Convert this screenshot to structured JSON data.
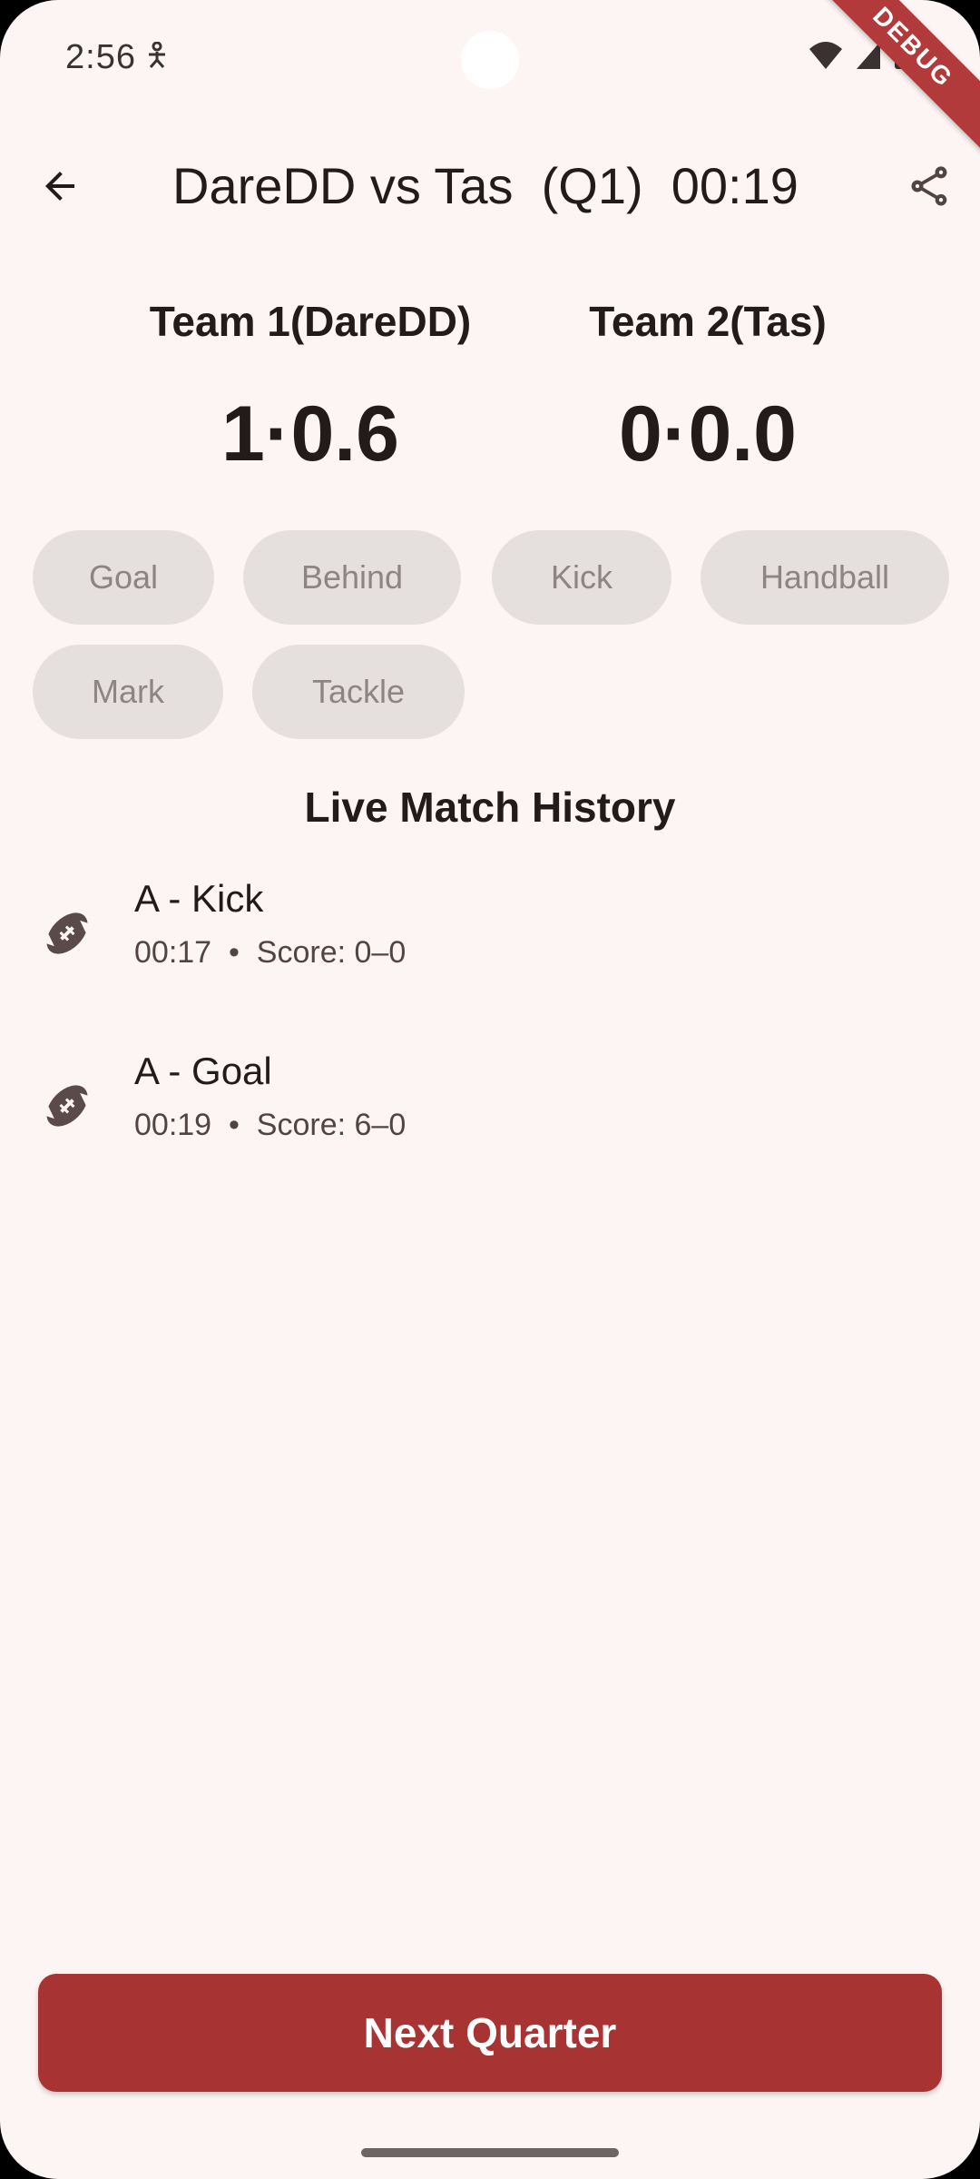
{
  "status_bar": {
    "time": "2:56",
    "icons": [
      "accessibility-icon",
      "wifi-icon",
      "signal-icon",
      "battery-icon"
    ]
  },
  "debug_banner": "DEBUG",
  "app_bar": {
    "title": "DareDD vs Tas  (Q1)  00:19",
    "back_icon": "arrow-back-icon",
    "share_icon": "share-icon"
  },
  "teams": [
    {
      "name": "Team 1(DareDD)",
      "score": "1·0.6"
    },
    {
      "name": "Team 2(Tas)",
      "score": "0·0.0"
    }
  ],
  "actions": [
    {
      "label": "Goal"
    },
    {
      "label": "Behind"
    },
    {
      "label": "Kick"
    },
    {
      "label": "Handball"
    },
    {
      "label": "Mark"
    },
    {
      "label": "Tackle"
    }
  ],
  "history": {
    "title": "Live Match History",
    "items": [
      {
        "title": "A - Kick",
        "time": "00:17",
        "score": "Score: 0–0",
        "icon": "football-icon"
      },
      {
        "title": "A - Goal",
        "time": "00:19",
        "score": "Score: 6–0",
        "icon": "football-icon"
      }
    ]
  },
  "next_button": "Next Quarter",
  "colors": {
    "background": "#fdf5f4",
    "chip_bg": "#e5dfde",
    "chip_text": "#8d8584",
    "primary": "#a83333",
    "text": "#231a19"
  }
}
